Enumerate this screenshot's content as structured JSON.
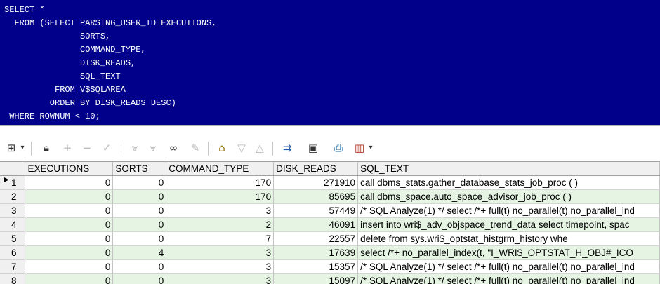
{
  "editor": {
    "sql_lines": [
      "SELECT *",
      "  FROM (SELECT PARSING_USER_ID EXECUTIONS,",
      "               SORTS,",
      "               COMMAND_TYPE,",
      "               DISK_READS,",
      "               SQL_TEXT",
      "          FROM V$SQLAREA",
      "         ORDER BY DISK_READS DESC)",
      " WHERE ROWNUM < 10;"
    ]
  },
  "toolbar": {
    "icons": [
      "grid-icon",
      "dropdown-arrow-icon",
      "lock-icon",
      "add-record-icon",
      "delete-record-icon",
      "post-icon",
      "filter-icon",
      "filter-alt-icon",
      "binoculars-icon",
      "clear-icon",
      "query-icon",
      "sort-desc-icon",
      "sort-asc-icon",
      "export-icon",
      "save-icon",
      "print-icon",
      "chart-icon",
      "dropdown-arrow-icon"
    ]
  },
  "grid": {
    "columns": [
      "EXECUTIONS",
      "SORTS",
      "COMMAND_TYPE",
      "DISK_READS",
      "SQL_TEXT"
    ],
    "current_row_marker": "▶",
    "rows": [
      {
        "n": "1",
        "executions": "0",
        "sorts": "0",
        "command_type": "170",
        "disk_reads": "271910",
        "sql_text": "call dbms_stats.gather_database_stats_job_proc ( )"
      },
      {
        "n": "2",
        "executions": "0",
        "sorts": "0",
        "command_type": "170",
        "disk_reads": "85695",
        "sql_text": "call dbms_space.auto_space_advisor_job_proc ( )"
      },
      {
        "n": "3",
        "executions": "0",
        "sorts": "0",
        "command_type": "3",
        "disk_reads": "57449",
        "sql_text": "/* SQL Analyze(1) */ select /*+ full(t) no_parallel(t) no_parallel_ind"
      },
      {
        "n": "4",
        "executions": "0",
        "sorts": "0",
        "command_type": "2",
        "disk_reads": "46091",
        "sql_text": "insert into wri$_adv_objspace_trend_data select timepoint,  spac"
      },
      {
        "n": "5",
        "executions": "0",
        "sorts": "0",
        "command_type": "7",
        "disk_reads": "22557",
        "sql_text": "delete from sys.wri$_optstat_histgrm_history                    whe"
      },
      {
        "n": "6",
        "executions": "0",
        "sorts": "4",
        "command_type": "3",
        "disk_reads": "17639",
        "sql_text": "select /*+ no_parallel_index(t, \"I_WRI$_OPTSTAT_H_OBJ#_ICO"
      },
      {
        "n": "7",
        "executions": "0",
        "sorts": "0",
        "command_type": "3",
        "disk_reads": "15357",
        "sql_text": "/* SQL Analyze(1) */ select /*+ full(t) no_parallel(t) no_parallel_ind"
      },
      {
        "n": "8",
        "executions": "0",
        "sorts": "0",
        "command_type": "3",
        "disk_reads": "15097",
        "sql_text": "/* SQL Analyze(1) */ select /*+ full(t) no_parallel(t) no_parallel_ind"
      }
    ]
  }
}
